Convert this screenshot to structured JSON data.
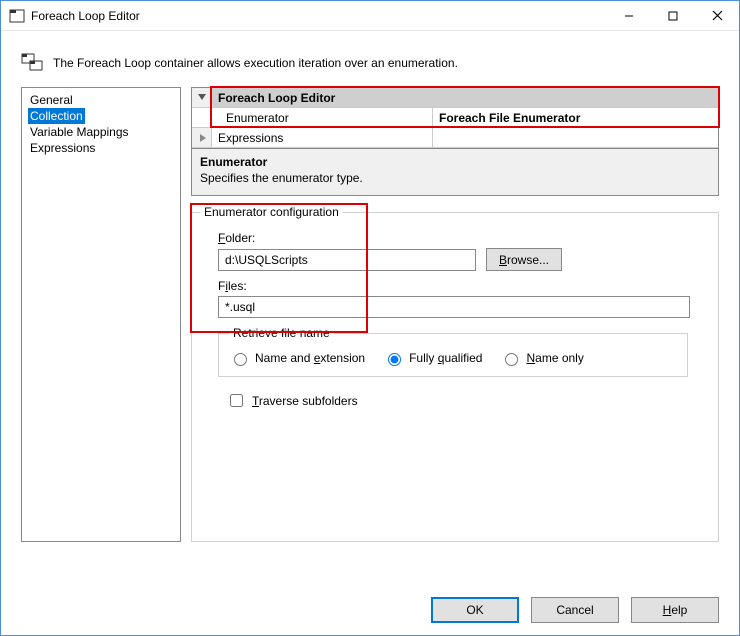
{
  "window": {
    "title": "Foreach Loop Editor"
  },
  "description": "The Foreach Loop container allows execution iteration over an enumeration.",
  "sidebar": {
    "items": [
      {
        "label": "General"
      },
      {
        "label": "Collection"
      },
      {
        "label": "Variable Mappings"
      },
      {
        "label": "Expressions"
      }
    ],
    "selected_index": 1
  },
  "property_grid": {
    "group_label": "Foreach Loop Editor",
    "rows": [
      {
        "name": "Enumerator",
        "value": "Foreach File Enumerator"
      },
      {
        "name": "Expressions",
        "value": ""
      }
    ]
  },
  "property_desc": {
    "header": "Enumerator",
    "body": "Specifies the enumerator type."
  },
  "config": {
    "legend": "Enumerator configuration",
    "folder_label": "Folder:",
    "folder_value": "d:\\USQLScripts",
    "browse_label": "Browse...",
    "files_label": "Files:",
    "files_value": "*.usql",
    "retrieve_legend": "Retrieve file name",
    "radios": {
      "name_ext": "Name and extension",
      "fully_qualified": "Fully qualified",
      "name_only": "Name only",
      "selected": "fully_qualified"
    },
    "traverse_label": "Traverse subfolders",
    "traverse_checked": false
  },
  "footer": {
    "ok": "OK",
    "cancel": "Cancel",
    "help": "Help"
  }
}
